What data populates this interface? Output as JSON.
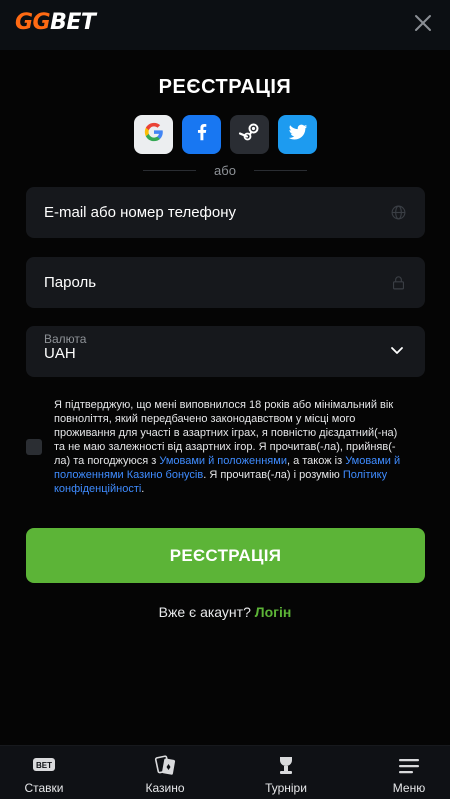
{
  "header": {
    "logo_gg": "GG",
    "logo_bet": "BET",
    "close_icon": "close-icon"
  },
  "registration": {
    "title": "РЕЄСТРАЦІЯ",
    "social": [
      "google-icon",
      "facebook-icon",
      "steam-icon",
      "twitter-icon"
    ],
    "or_text": "або",
    "email_placeholder": "E-mail або номер телефону",
    "password_placeholder": "Пароль",
    "currency_label": "Валюта",
    "currency_value": "UAH",
    "agreement": {
      "text1": "Я підтверджую, що мені виповнилося 18 років або мінімальний вік повноліття, який передбачено законодавством у місці мого проживання для участі в азартних іграх, я повністю дієздатний(-на) та не маю залежності від азартних ігор. Я прочитав(-ла), прийняв(-ла) та погоджуюся з ",
      "link1": "Умовами й положеннями",
      "text2": ", а також із ",
      "link2": "Умовами й положеннями Казино бонусів",
      "text3": ". Я прочитав(-ла) і розумію ",
      "link3": "Політику конфіденційності",
      "text4": "."
    },
    "submit_label": "РЕЄСТРАЦІЯ",
    "have_account": "Вже є акаунт?",
    "login_link": "Логін"
  },
  "bottom_nav": {
    "bets": "Ставки",
    "casino": "Казино",
    "tournaments": "Турніри",
    "menu": "Меню"
  },
  "colors": {
    "accent_orange": "#ff6a13",
    "accent_green": "#5cb437",
    "link_blue": "#3f8cff",
    "background": "#050505",
    "field_bg": "#16181c"
  }
}
